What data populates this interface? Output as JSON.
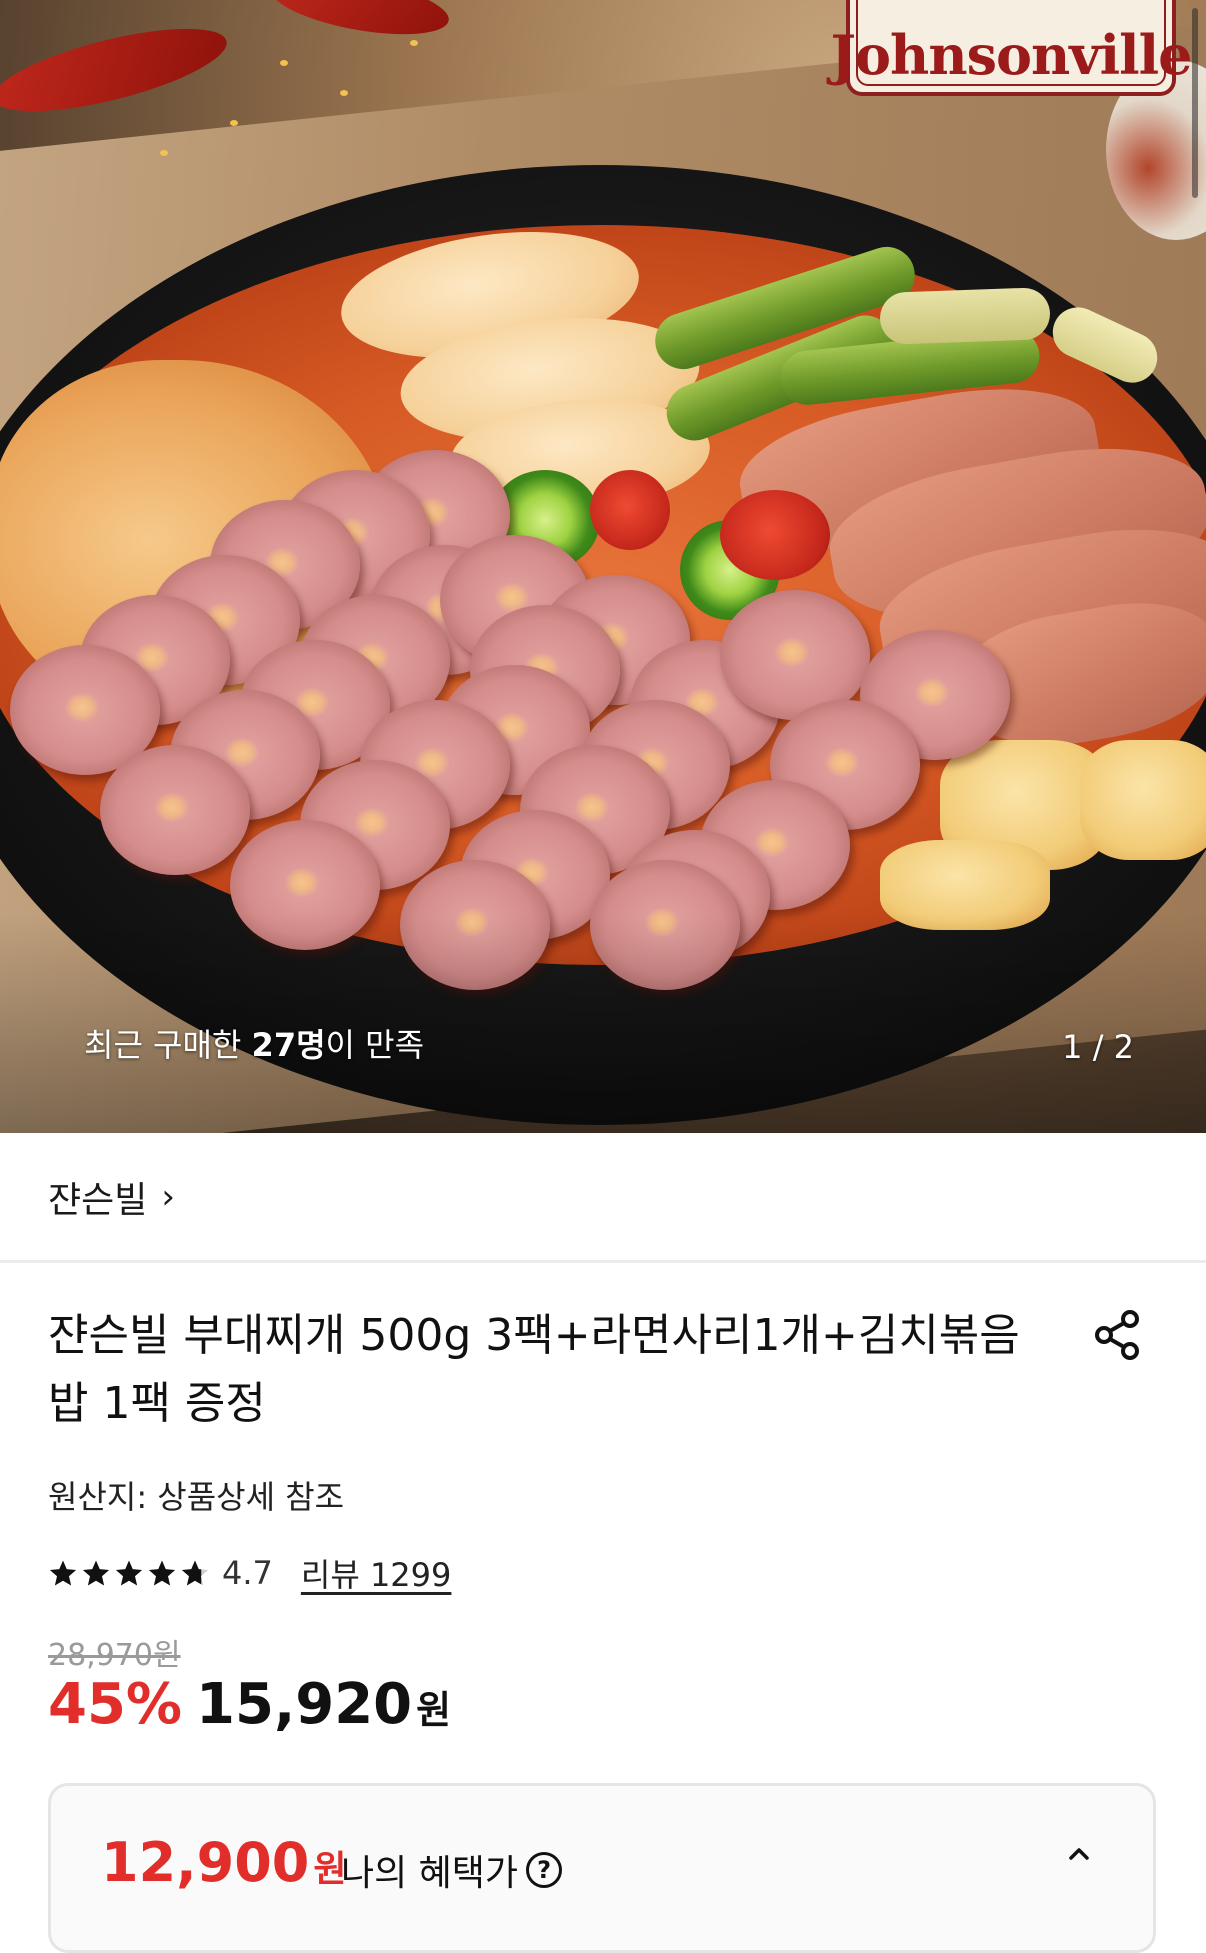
{
  "hero": {
    "logo_text": "Johnsonville",
    "caption_prefix": "최근 구매한 ",
    "caption_count": "27명",
    "caption_suffix": "이 만족",
    "pager": "1 / 2"
  },
  "brand": {
    "name": "쟌슨빌",
    "chevron": "›"
  },
  "product": {
    "title": "쟌슨빌 부대찌개 500g 3팩+라면사리1개+김치볶음밥 1팩 증정",
    "origin": "원산지: 상품상세 참조",
    "rating": {
      "stars": 4.7,
      "value": "4.7",
      "review_label": "리뷰 1299"
    },
    "original_price": "28,970원",
    "discount": "45%",
    "sale_price": "15,920",
    "sale_unit": "원"
  },
  "benefit": {
    "price": "12,900",
    "unit": "원",
    "label": "나의 혜택가",
    "help_glyph": "?"
  },
  "icons": {
    "share": "share-icon",
    "chevron_up": "chevron-up-icon",
    "help": "help-icon",
    "star": "star-icon"
  }
}
